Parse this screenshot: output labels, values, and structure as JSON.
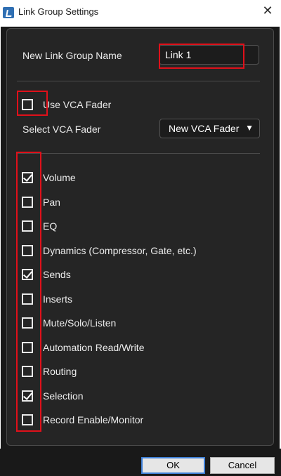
{
  "window": {
    "title": "Link Group Settings",
    "close_glyph": "✕",
    "app_icon": "app-logo-icon"
  },
  "name_section": {
    "label": "New Link Group Name",
    "value": "Link 1"
  },
  "vca_section": {
    "use_vca_label": "Use VCA Fader",
    "use_vca_checked": false,
    "select_label": "Select VCA Fader",
    "dropdown_value": "New VCA Fader",
    "dropdown_arrow": "▼"
  },
  "options": [
    {
      "label": "Volume",
      "checked": true
    },
    {
      "label": "Pan",
      "checked": false
    },
    {
      "label": "EQ",
      "checked": false
    },
    {
      "label": "Dynamics (Compressor, Gate, etc.)",
      "checked": false
    },
    {
      "label": "Sends",
      "checked": true
    },
    {
      "label": "Inserts",
      "checked": false
    },
    {
      "label": "Mute/Solo/Listen",
      "checked": false
    },
    {
      "label": "Automation Read/Write",
      "checked": false
    },
    {
      "label": "Routing",
      "checked": false
    },
    {
      "label": "Selection",
      "checked": true
    },
    {
      "label": "Record Enable/Monitor",
      "checked": false
    }
  ],
  "buttons": {
    "ok": "OK",
    "cancel": "Cancel"
  },
  "colors": {
    "annotation": "#e0101a",
    "background": "#191919",
    "panel": "#252525",
    "ok_focus": "#3f7fd6"
  }
}
